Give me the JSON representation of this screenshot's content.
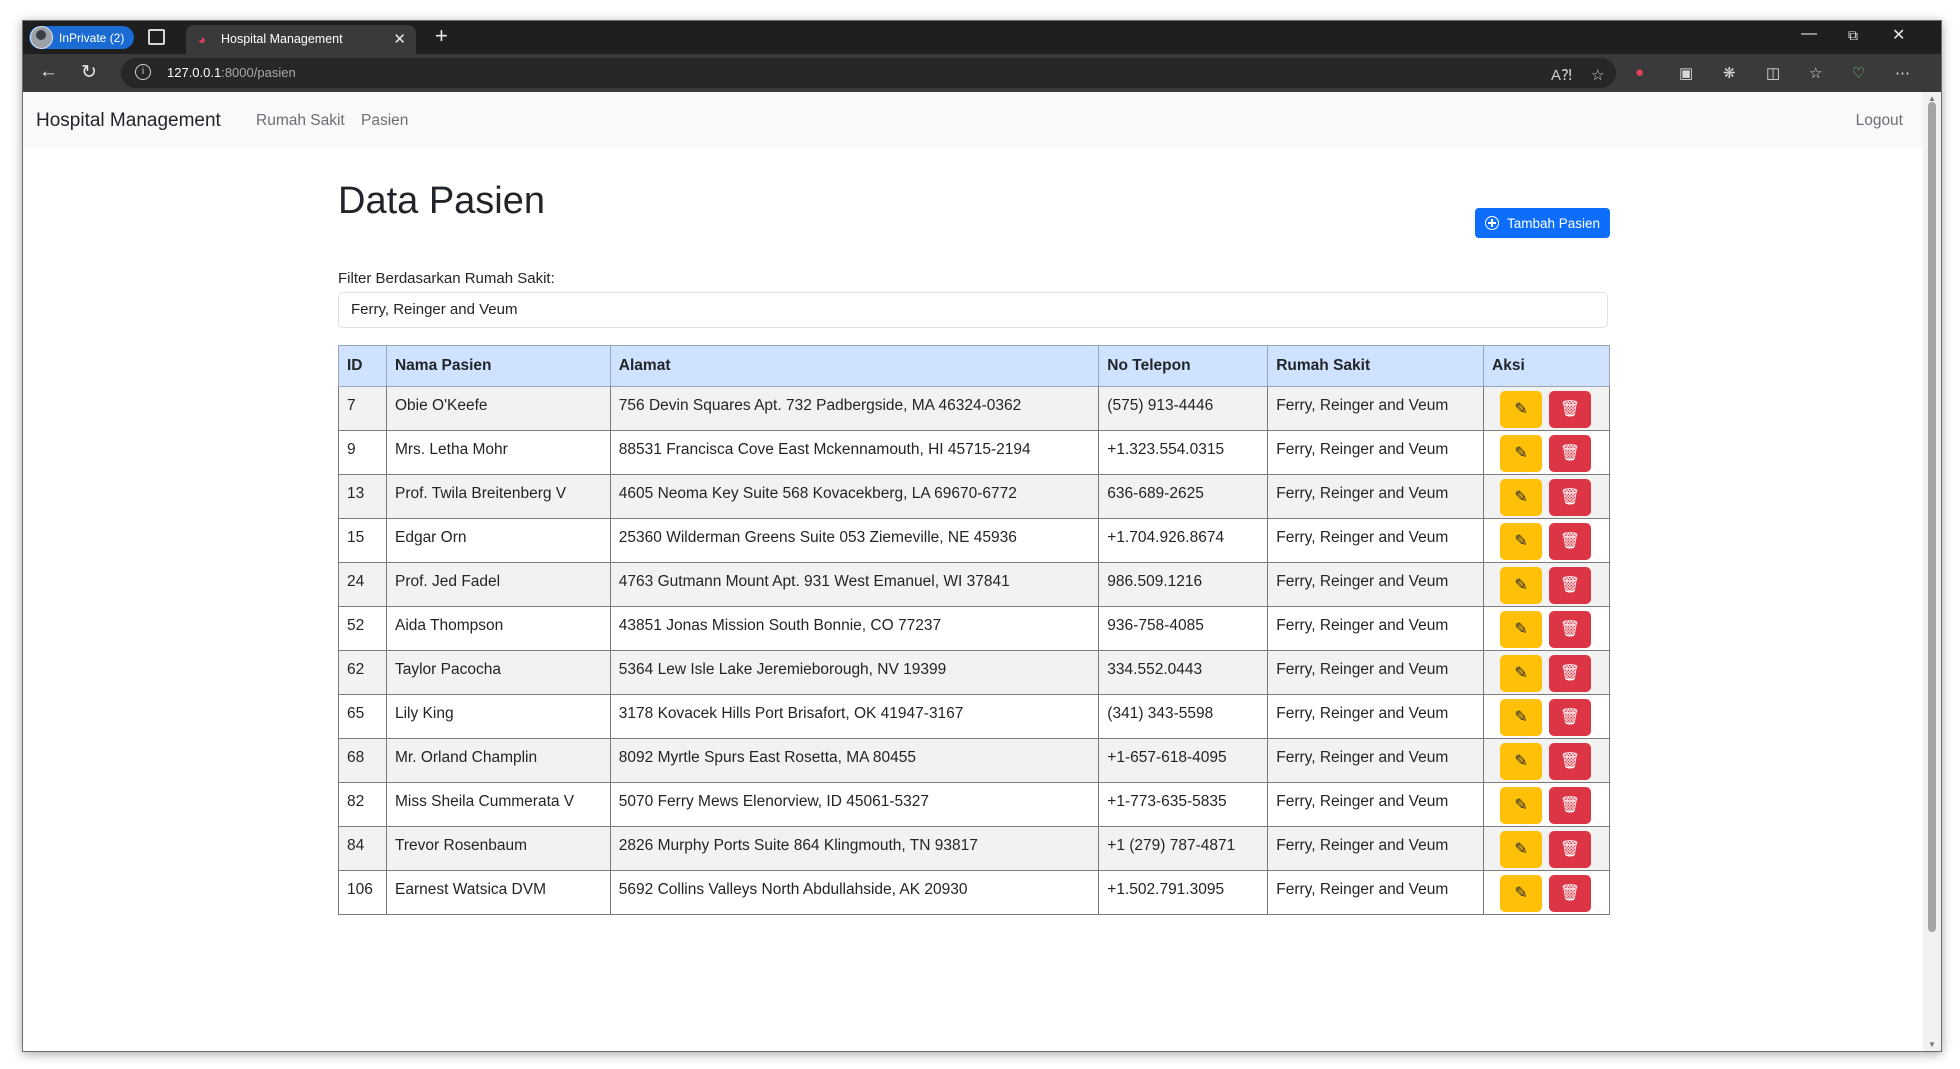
{
  "browser": {
    "profile_label": "InPrivate (2)",
    "tab_title": "Hospital Management",
    "url_host": "127.0.0.1",
    "url_path": ":8000/pasien"
  },
  "navbar": {
    "brand": "Hospital Management",
    "links": [
      "Rumah Sakit",
      "Pasien"
    ],
    "logout": "Logout"
  },
  "main": {
    "title": "Data Pasien",
    "add_button": "Tambah Pasien",
    "filter_label": "Filter Berdasarkan Rumah Sakit:",
    "filter_value": "Ferry, Reinger and Veum"
  },
  "table": {
    "headers": [
      "ID",
      "Nama Pasien",
      "Alamat",
      "No Telepon",
      "Rumah Sakit",
      "Aksi"
    ],
    "rows": [
      {
        "id": "7",
        "name": "Obie O'Keefe",
        "address": "756 Devin Squares Apt. 732 Padbergside, MA 46324-0362",
        "phone": "(575) 913-4446",
        "hospital": "Ferry, Reinger and Veum"
      },
      {
        "id": "9",
        "name": "Mrs. Letha Mohr",
        "address": "88531 Francisca Cove East Mckennamouth, HI 45715-2194",
        "phone": "+1.323.554.0315",
        "hospital": "Ferry, Reinger and Veum"
      },
      {
        "id": "13",
        "name": "Prof. Twila Breitenberg V",
        "address": "4605 Neoma Key Suite 568 Kovacekberg, LA 69670-6772",
        "phone": "636-689-2625",
        "hospital": "Ferry, Reinger and Veum"
      },
      {
        "id": "15",
        "name": "Edgar Orn",
        "address": "25360 Wilderman Greens Suite 053 Ziemeville, NE 45936",
        "phone": "+1.704.926.8674",
        "hospital": "Ferry, Reinger and Veum"
      },
      {
        "id": "24",
        "name": "Prof. Jed Fadel",
        "address": "4763 Gutmann Mount Apt. 931 West Emanuel, WI 37841",
        "phone": "986.509.1216",
        "hospital": "Ferry, Reinger and Veum"
      },
      {
        "id": "52",
        "name": "Aida Thompson",
        "address": "43851 Jonas Mission South Bonnie, CO 77237",
        "phone": "936-758-4085",
        "hospital": "Ferry, Reinger and Veum"
      },
      {
        "id": "62",
        "name": "Taylor Pacocha",
        "address": "5364 Lew Isle Lake Jeremieborough, NV 19399",
        "phone": "334.552.0443",
        "hospital": "Ferry, Reinger and Veum"
      },
      {
        "id": "65",
        "name": "Lily King",
        "address": "3178 Kovacek Hills Port Brisafort, OK 41947-3167",
        "phone": "(341) 343-5598",
        "hospital": "Ferry, Reinger and Veum"
      },
      {
        "id": "68",
        "name": "Mr. Orland Champlin",
        "address": "8092 Myrtle Spurs East Rosetta, MA 80455",
        "phone": "+1-657-618-4095",
        "hospital": "Ferry, Reinger and Veum"
      },
      {
        "id": "82",
        "name": "Miss Sheila Cummerata V",
        "address": "5070 Ferry Mews Elenorview, ID 45061-5327",
        "phone": "+1-773-635-5835",
        "hospital": "Ferry, Reinger and Veum"
      },
      {
        "id": "84",
        "name": "Trevor Rosenbaum",
        "address": "2826 Murphy Ports Suite 864 Klingmouth, TN 93817",
        "phone": "+1 (279) 787-4871",
        "hospital": "Ferry, Reinger and Veum"
      },
      {
        "id": "106",
        "name": "Earnest Watsica DVM",
        "address": "5692 Collins Valleys North Abdullahside, AK 20930",
        "phone": "+1.502.791.3095",
        "hospital": "Ferry, Reinger and Veum"
      }
    ]
  },
  "icons": {
    "edit": "edit-icon",
    "delete": "trash-icon"
  },
  "colors": {
    "primary": "#0d6efd",
    "warning": "#ffc107",
    "danger": "#dc3545",
    "table_header": "#cfe2ff"
  }
}
